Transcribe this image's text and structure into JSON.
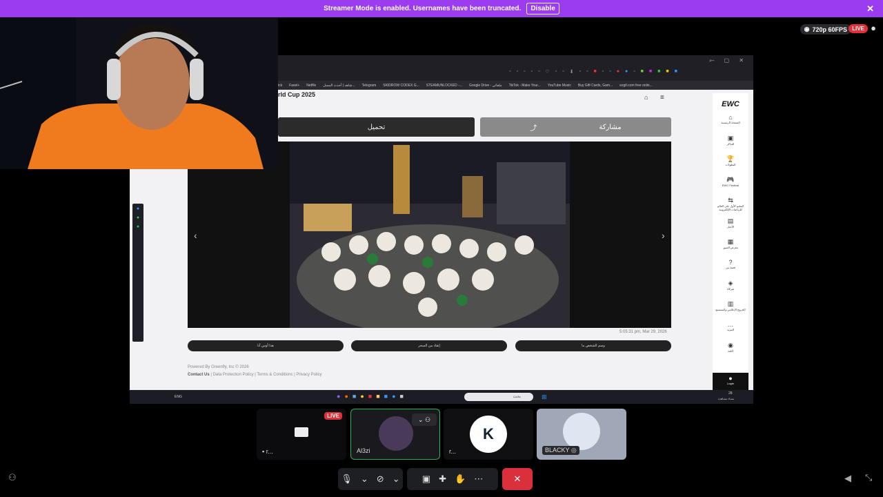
{
  "banner": {
    "text": "Streamer Mode is enabled. Usernames have been truncated.",
    "button": "Disable",
    "close": "✕"
  },
  "stream": {
    "quality": "720p 60FPS",
    "live": "LIVE"
  },
  "browser": {
    "bookmarks": [
      "ick",
      "Fasel+",
      "Netflix",
      "شاهد | أحدث المسل...",
      "Telegram",
      "SKIDROW CODEX G...",
      "STEAMUNLOCKED -...",
      "Google Drive - ملفاتي",
      "TikTok - Make Your...",
      "YouTube Music",
      "Buy Gift Cards, Gam...",
      "ezgif.com free onlin..."
    ]
  },
  "page": {
    "title": "rld Cup 2025",
    "download_label": "تحميل",
    "share_label": "مشاركة",
    "prev": "‹",
    "next": "›",
    "timestamp": "5:05:31 pm, Mar 29, 2026",
    "pills": [
      "هذا أوس أنا",
      "إنقاذ من السحر",
      "وسم الشخص ما"
    ],
    "footer_powered": "Powered By Greenfly, Inc © 2026",
    "footer_links": [
      "Contact Us",
      "Data Protection Policy",
      "Terms & Conditions",
      "Privacy Policy"
    ]
  },
  "sidebar": {
    "logo": "EWC",
    "items": [
      {
        "icon": "⌂",
        "label": "الصفحة الرئيسية"
      },
      {
        "icon": "▣",
        "label": "التذاكر"
      },
      {
        "icon": "🏆",
        "label": "البطولات"
      },
      {
        "icon": "🎮",
        "label": "EWC Festival"
      },
      {
        "icon": "⇆",
        "label": "المقيم الأول على العالم للرياضات الإلكترونية"
      },
      {
        "icon": "▤",
        "label": "الأخبار"
      },
      {
        "icon": "▦",
        "label": "معرض الصور"
      },
      {
        "icon": "?",
        "label": "قصة من"
      },
      {
        "icon": "◈",
        "label": "شركاء"
      },
      {
        "icon": "▥",
        "label": "الخروج الإعلامي والمستمع"
      },
      {
        "icon": "…",
        "label": "المزيد"
      },
      {
        "icon": "◉",
        "label": "اللغة"
      },
      {
        "icon": "●",
        "label": "Login"
      }
    ]
  },
  "taskbar": {
    "lang": "ENG",
    "search_placeholder": "بحث",
    "clock": "28",
    "date": "مساء مشاهدة"
  },
  "tiles": [
    {
      "name": "r...",
      "live": "LIVE"
    },
    {
      "name": "Al3zi"
    },
    {
      "name": "r..."
    },
    {
      "name": "BLACKY"
    }
  ],
  "colors": {
    "banner": "#9b3cf0",
    "live": "#e0303a",
    "end_call": "#d9303c",
    "tile_active_border": "#2fb35a"
  }
}
